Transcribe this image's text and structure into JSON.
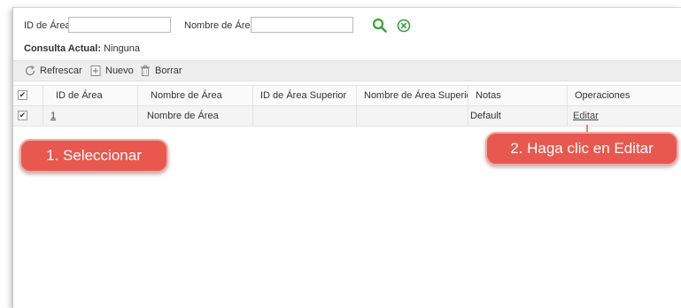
{
  "search": {
    "id_label": "ID de Área",
    "id_value": "",
    "name_label": "Nombre de Área",
    "name_value": ""
  },
  "consulta": {
    "label": "Consulta Actual:",
    "value": "Ninguna"
  },
  "toolbar": {
    "refresh": "Refrescar",
    "new": "Nuevo",
    "delete": "Borrar"
  },
  "table": {
    "headers": [
      "ID de Área",
      "Nombre de Área",
      "ID de Área Superior",
      "Nombre de Área Superior",
      "Notas",
      "Operaciones"
    ],
    "rows": [
      {
        "checked": true,
        "id": "1",
        "name": "Nombre de Área",
        "parent_id": "",
        "parent_name": "",
        "notes": "Default",
        "operation": "Editar"
      }
    ]
  },
  "callouts": {
    "select": "1. Seleccionar",
    "edit": "2. Haga clic en Editar"
  },
  "colors": {
    "accent_search": "#3aa03a",
    "accent_clear": "#3aa03a",
    "callout": "#e8584f"
  }
}
